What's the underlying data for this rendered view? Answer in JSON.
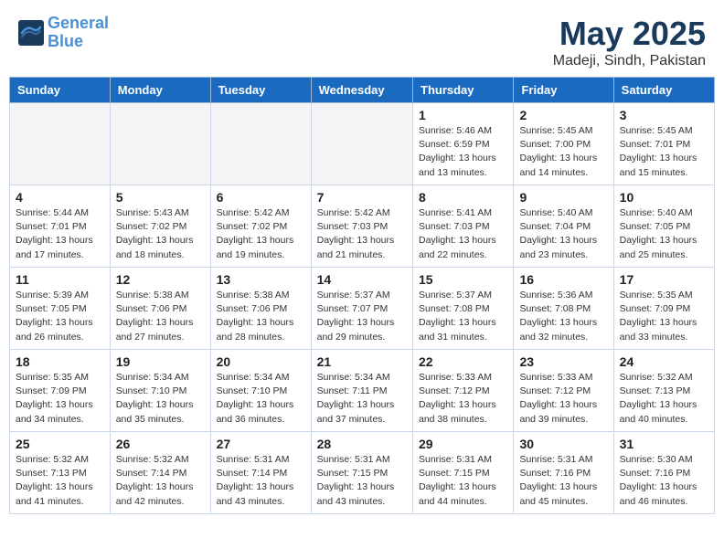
{
  "header": {
    "logo_line1": "General",
    "logo_line2": "Blue",
    "title": "May 2025",
    "subtitle": "Madeji, Sindh, Pakistan"
  },
  "calendar": {
    "days_of_week": [
      "Sunday",
      "Monday",
      "Tuesday",
      "Wednesday",
      "Thursday",
      "Friday",
      "Saturday"
    ],
    "weeks": [
      [
        {
          "day": "",
          "info": ""
        },
        {
          "day": "",
          "info": ""
        },
        {
          "day": "",
          "info": ""
        },
        {
          "day": "",
          "info": ""
        },
        {
          "day": "1",
          "info": "Sunrise: 5:46 AM\nSunset: 6:59 PM\nDaylight: 13 hours\nand 13 minutes."
        },
        {
          "day": "2",
          "info": "Sunrise: 5:45 AM\nSunset: 7:00 PM\nDaylight: 13 hours\nand 14 minutes."
        },
        {
          "day": "3",
          "info": "Sunrise: 5:45 AM\nSunset: 7:01 PM\nDaylight: 13 hours\nand 15 minutes."
        }
      ],
      [
        {
          "day": "4",
          "info": "Sunrise: 5:44 AM\nSunset: 7:01 PM\nDaylight: 13 hours\nand 17 minutes."
        },
        {
          "day": "5",
          "info": "Sunrise: 5:43 AM\nSunset: 7:02 PM\nDaylight: 13 hours\nand 18 minutes."
        },
        {
          "day": "6",
          "info": "Sunrise: 5:42 AM\nSunset: 7:02 PM\nDaylight: 13 hours\nand 19 minutes."
        },
        {
          "day": "7",
          "info": "Sunrise: 5:42 AM\nSunset: 7:03 PM\nDaylight: 13 hours\nand 21 minutes."
        },
        {
          "day": "8",
          "info": "Sunrise: 5:41 AM\nSunset: 7:03 PM\nDaylight: 13 hours\nand 22 minutes."
        },
        {
          "day": "9",
          "info": "Sunrise: 5:40 AM\nSunset: 7:04 PM\nDaylight: 13 hours\nand 23 minutes."
        },
        {
          "day": "10",
          "info": "Sunrise: 5:40 AM\nSunset: 7:05 PM\nDaylight: 13 hours\nand 25 minutes."
        }
      ],
      [
        {
          "day": "11",
          "info": "Sunrise: 5:39 AM\nSunset: 7:05 PM\nDaylight: 13 hours\nand 26 minutes."
        },
        {
          "day": "12",
          "info": "Sunrise: 5:38 AM\nSunset: 7:06 PM\nDaylight: 13 hours\nand 27 minutes."
        },
        {
          "day": "13",
          "info": "Sunrise: 5:38 AM\nSunset: 7:06 PM\nDaylight: 13 hours\nand 28 minutes."
        },
        {
          "day": "14",
          "info": "Sunrise: 5:37 AM\nSunset: 7:07 PM\nDaylight: 13 hours\nand 29 minutes."
        },
        {
          "day": "15",
          "info": "Sunrise: 5:37 AM\nSunset: 7:08 PM\nDaylight: 13 hours\nand 31 minutes."
        },
        {
          "day": "16",
          "info": "Sunrise: 5:36 AM\nSunset: 7:08 PM\nDaylight: 13 hours\nand 32 minutes."
        },
        {
          "day": "17",
          "info": "Sunrise: 5:35 AM\nSunset: 7:09 PM\nDaylight: 13 hours\nand 33 minutes."
        }
      ],
      [
        {
          "day": "18",
          "info": "Sunrise: 5:35 AM\nSunset: 7:09 PM\nDaylight: 13 hours\nand 34 minutes."
        },
        {
          "day": "19",
          "info": "Sunrise: 5:34 AM\nSunset: 7:10 PM\nDaylight: 13 hours\nand 35 minutes."
        },
        {
          "day": "20",
          "info": "Sunrise: 5:34 AM\nSunset: 7:10 PM\nDaylight: 13 hours\nand 36 minutes."
        },
        {
          "day": "21",
          "info": "Sunrise: 5:34 AM\nSunset: 7:11 PM\nDaylight: 13 hours\nand 37 minutes."
        },
        {
          "day": "22",
          "info": "Sunrise: 5:33 AM\nSunset: 7:12 PM\nDaylight: 13 hours\nand 38 minutes."
        },
        {
          "day": "23",
          "info": "Sunrise: 5:33 AM\nSunset: 7:12 PM\nDaylight: 13 hours\nand 39 minutes."
        },
        {
          "day": "24",
          "info": "Sunrise: 5:32 AM\nSunset: 7:13 PM\nDaylight: 13 hours\nand 40 minutes."
        }
      ],
      [
        {
          "day": "25",
          "info": "Sunrise: 5:32 AM\nSunset: 7:13 PM\nDaylight: 13 hours\nand 41 minutes."
        },
        {
          "day": "26",
          "info": "Sunrise: 5:32 AM\nSunset: 7:14 PM\nDaylight: 13 hours\nand 42 minutes."
        },
        {
          "day": "27",
          "info": "Sunrise: 5:31 AM\nSunset: 7:14 PM\nDaylight: 13 hours\nand 43 minutes."
        },
        {
          "day": "28",
          "info": "Sunrise: 5:31 AM\nSunset: 7:15 PM\nDaylight: 13 hours\nand 43 minutes."
        },
        {
          "day": "29",
          "info": "Sunrise: 5:31 AM\nSunset: 7:15 PM\nDaylight: 13 hours\nand 44 minutes."
        },
        {
          "day": "30",
          "info": "Sunrise: 5:31 AM\nSunset: 7:16 PM\nDaylight: 13 hours\nand 45 minutes."
        },
        {
          "day": "31",
          "info": "Sunrise: 5:30 AM\nSunset: 7:16 PM\nDaylight: 13 hours\nand 46 minutes."
        }
      ]
    ]
  }
}
